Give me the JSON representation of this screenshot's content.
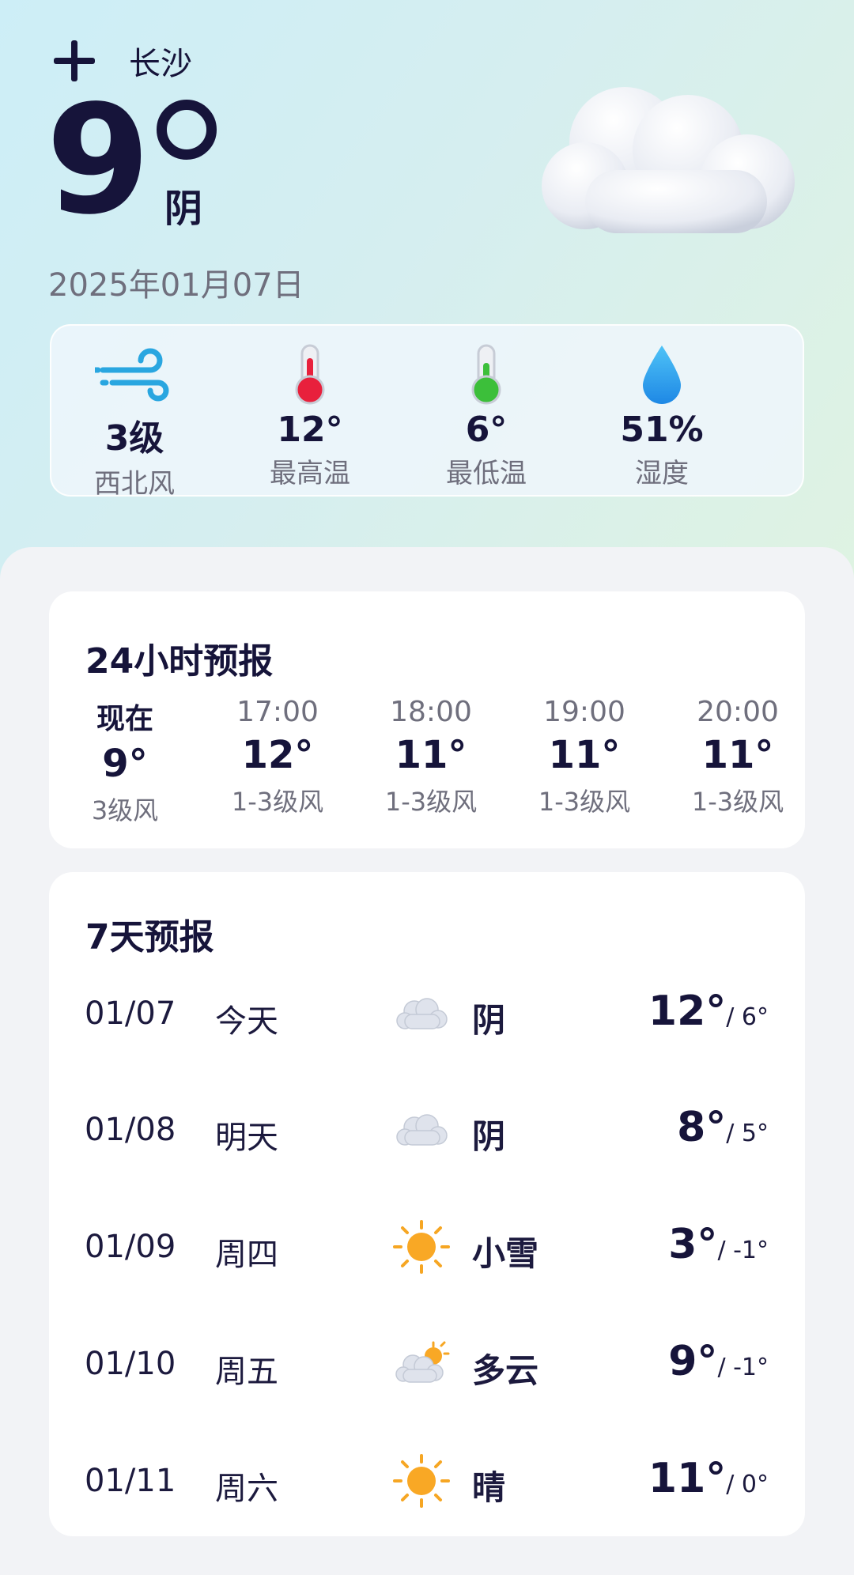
{
  "header": {
    "city": "长沙",
    "temperature": "9",
    "condition": "阴",
    "date": "2025年01月07日"
  },
  "stats": [
    {
      "icon": "wind-icon",
      "value": "3级",
      "label": "西北风"
    },
    {
      "icon": "thermometer-high-icon",
      "value": "12°",
      "label": "最高温"
    },
    {
      "icon": "thermometer-low-icon",
      "value": "6°",
      "label": "最低温"
    },
    {
      "icon": "water-drop-icon",
      "value": "51%",
      "label": "湿度"
    }
  ],
  "hourly": {
    "title": "24小时预报",
    "items": [
      {
        "time": "现在",
        "temp": "9°",
        "wind": "3级风"
      },
      {
        "time": "17:00",
        "temp": "12°",
        "wind": "1-3级风"
      },
      {
        "time": "18:00",
        "temp": "11°",
        "wind": "1-3级风"
      },
      {
        "time": "19:00",
        "temp": "11°",
        "wind": "1-3级风"
      },
      {
        "time": "20:00",
        "temp": "11°",
        "wind": "1-3级风"
      }
    ]
  },
  "weekly": {
    "title": "7天预报",
    "days": [
      {
        "date": "01/07",
        "name": "今天",
        "icon": "cloud-icon",
        "cond": "阴",
        "high": "12°",
        "low": "/ 6°"
      },
      {
        "date": "01/08",
        "name": "明天",
        "icon": "cloud-icon",
        "cond": "阴",
        "high": "8°",
        "low": "/ 5°"
      },
      {
        "date": "01/09",
        "name": "周四",
        "icon": "sun-icon",
        "cond": "小雪",
        "high": "3°",
        "low": "/ -1°"
      },
      {
        "date": "01/10",
        "name": "周五",
        "icon": "partly-cloudy-icon",
        "cond": "多云",
        "high": "9°",
        "low": "/ -1°"
      },
      {
        "date": "01/11",
        "name": "周六",
        "icon": "sun-icon",
        "cond": "晴",
        "high": "11°",
        "low": "/ 0°"
      }
    ]
  }
}
